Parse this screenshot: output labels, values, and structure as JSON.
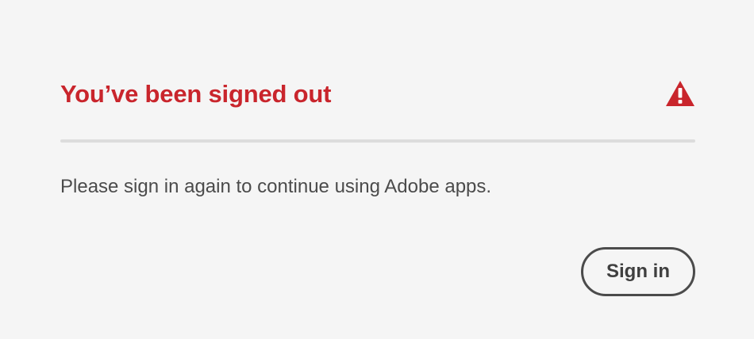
{
  "dialog": {
    "title": "You’ve been signed out",
    "message": "Please sign in again to continue using Adobe apps.",
    "sign_in_label": "Sign in",
    "alert_icon": "alert-triangle-icon"
  },
  "colors": {
    "title": "#c9252c",
    "alert_icon": "#c9252c",
    "text": "#4b4b4b",
    "background": "#f5f5f5",
    "divider": "#dcdcdc",
    "button_border": "#4b4b4b"
  }
}
